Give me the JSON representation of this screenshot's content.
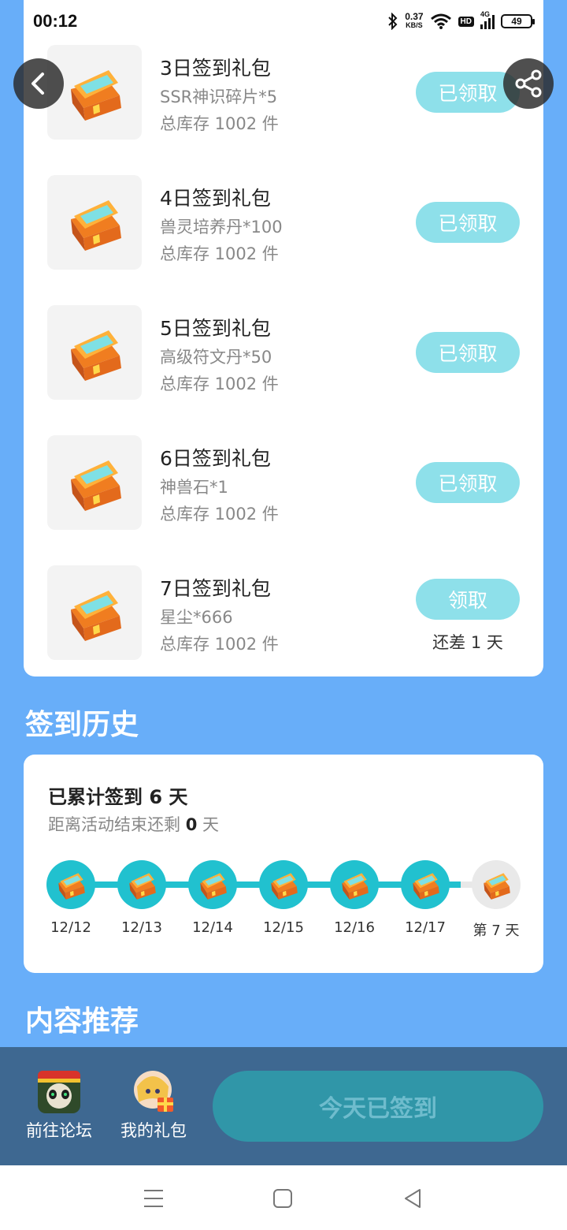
{
  "status_bar": {
    "time": "00:12",
    "net_speed": "0.37",
    "net_unit": "KB/S",
    "hd": "HD",
    "network": "4G",
    "battery": "49",
    "icons": [
      "bluetooth-icon",
      "wifi-icon",
      "signal-icon",
      "battery-icon"
    ]
  },
  "nav": {
    "back_icon": "chevron-left-icon",
    "share_icon": "share-icon"
  },
  "gifts": [
    {
      "title": "3日签到礼包",
      "desc": "SSR神识碎片*5",
      "stock": "总库存 1002 件",
      "button": "已领取"
    },
    {
      "title": "4日签到礼包",
      "desc": "兽灵培养丹*100",
      "stock": "总库存 1002 件",
      "button": "已领取"
    },
    {
      "title": "5日签到礼包",
      "desc": "高级符文丹*50",
      "stock": "总库存 1002 件",
      "button": "已领取"
    },
    {
      "title": "6日签到礼包",
      "desc": "神兽石*1",
      "stock": "总库存 1002 件",
      "button": "已领取"
    },
    {
      "title": "7日签到礼包",
      "desc": "星尘*666",
      "stock": "总库存 1002 件",
      "button": "领取",
      "remain": "还差 1 天"
    }
  ],
  "history": {
    "section_title": "签到历史",
    "count_label": "已累计签到 6 天",
    "remaining_prefix": "距离活动结束还剩",
    "remaining_value": "0",
    "remaining_suffix": "天",
    "days": [
      {
        "label": "12/12",
        "done": true
      },
      {
        "label": "12/13",
        "done": true
      },
      {
        "label": "12/14",
        "done": true
      },
      {
        "label": "12/15",
        "done": true
      },
      {
        "label": "12/16",
        "done": true
      },
      {
        "label": "12/17",
        "done": true
      },
      {
        "label": "第 7 天",
        "done": false
      }
    ]
  },
  "recommend": {
    "section_title": "内容推荐"
  },
  "bottom_bar": {
    "forum_label": "前往论坛",
    "gifts_label": "我的礼包",
    "signed_label": "今天已签到"
  },
  "colors": {
    "page_bg": "#68aef9",
    "accent_teal": "#21c1cf",
    "claimed_button": "#8ee0ea",
    "bottom_bar": "#3e6891"
  }
}
